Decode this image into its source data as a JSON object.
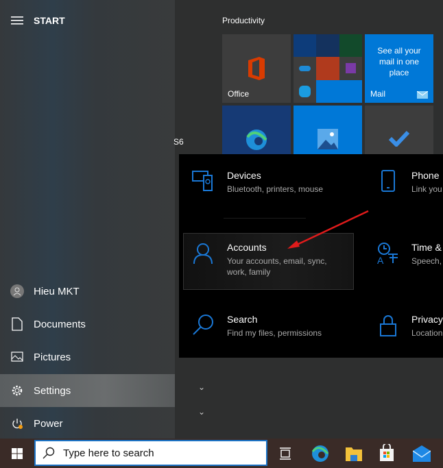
{
  "start": {
    "title": "START",
    "menu_icon": "hamburger-icon"
  },
  "sidebar": {
    "items": [
      {
        "label": "Hieu MKT",
        "icon": "avatar"
      },
      {
        "label": "Documents",
        "icon": "document-icon"
      },
      {
        "label": "Pictures",
        "icon": "pictures-icon"
      },
      {
        "label": "Settings",
        "icon": "gear-icon"
      },
      {
        "label": "Power",
        "icon": "power-icon"
      }
    ],
    "partial_text": "S6"
  },
  "tiles": {
    "group_title": "Productivity",
    "office": "Office",
    "mail_promo": "See all your mail in one place",
    "mail": "Mail"
  },
  "settings": {
    "items": [
      {
        "title": "Devices",
        "desc": "Bluetooth, printers, mouse"
      },
      {
        "title": "Phone",
        "desc": "Link you"
      },
      {
        "title": "Accounts",
        "desc": "Your accounts, email, sync, work, family"
      },
      {
        "title": "Time &",
        "desc": "Speech,"
      },
      {
        "title": "Search",
        "desc": "Find my files, permissions"
      },
      {
        "title": "Privacy",
        "desc": "Location"
      }
    ],
    "accent": "#1a78d6"
  },
  "taskbar": {
    "search_placeholder": "Type here to search"
  },
  "colors": {
    "annotation_arrow": "#e01b1b",
    "tile_blue": "#0078d7"
  }
}
